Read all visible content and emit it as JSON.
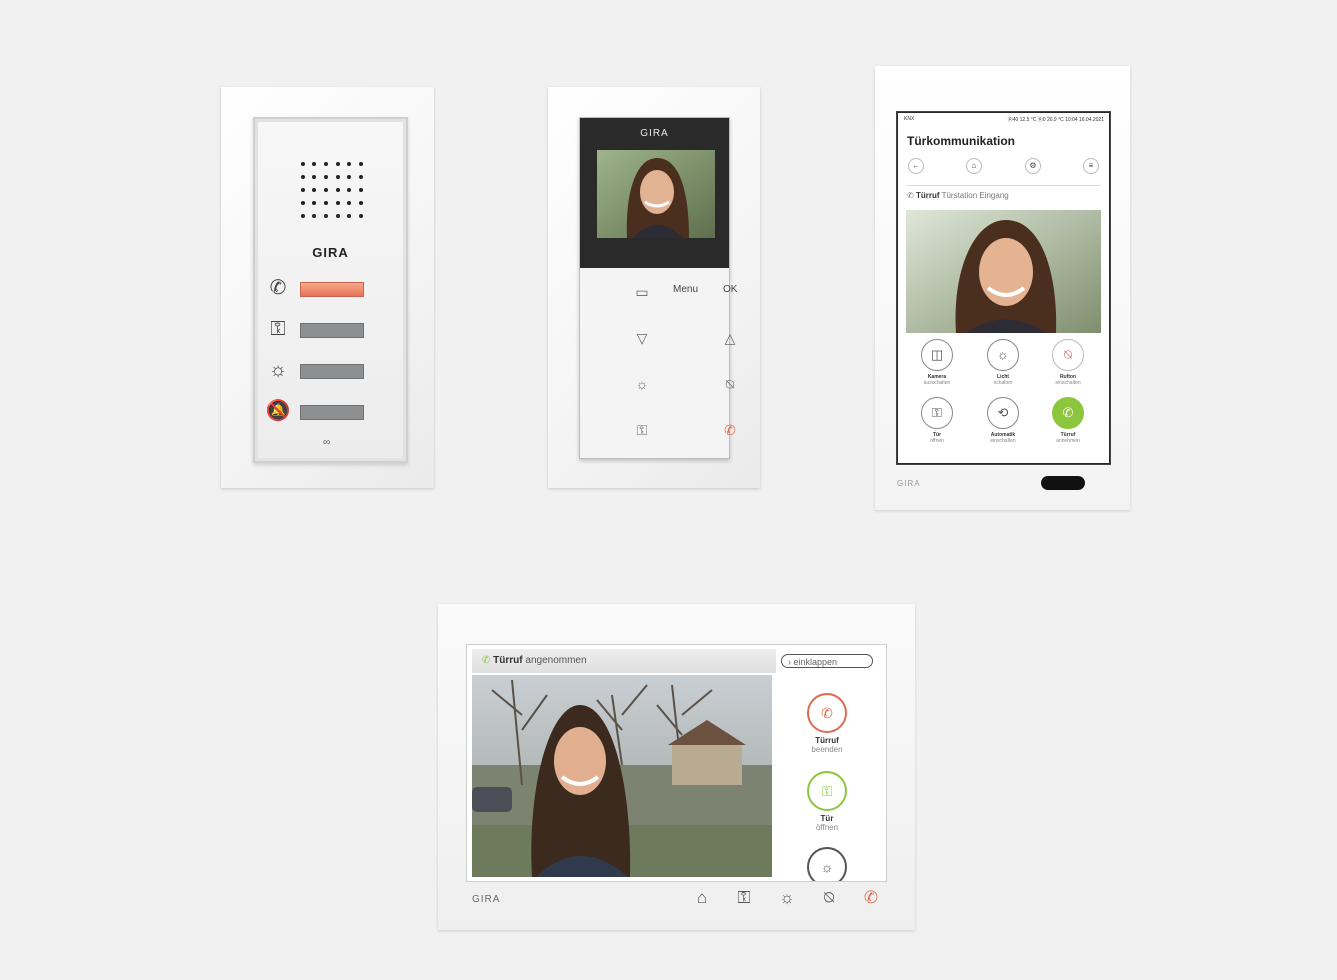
{
  "device1": {
    "brand": "GIRA",
    "icons": [
      "handset-icon",
      "key-icon",
      "light-icon",
      "bell-mute-icon"
    ],
    "glyphs": [
      "✆",
      "⚿",
      "☼",
      "🔕"
    ],
    "mini_symbol": "∞"
  },
  "device2": {
    "brand": "GIRA",
    "menu_label": "Menu",
    "ok_label": "OK",
    "glyphs": {
      "book": "▭",
      "down": "▽",
      "up": "△",
      "light": "☼",
      "mute": "⍉",
      "key": "⚿",
      "handset": "✆"
    }
  },
  "device3": {
    "status_left": "KNX",
    "status_right": "Ⓡ40 12.5 °C  Ⓡ0 20.9 °C  10:04  16.04.2021",
    "title": "Türkommunikation",
    "call_label": "Türruf",
    "call_source": "Türstation Eingang",
    "actions": [
      {
        "t1": "Kamera",
        "t2": "ausschalten",
        "glyph": "◫"
      },
      {
        "t1": "Licht",
        "t2": "schalten",
        "glyph": "☼"
      },
      {
        "t1": "Rufton",
        "t2": "einschalten",
        "glyph": "⍉"
      },
      {
        "t1": "Tür",
        "t2": "öffnen",
        "glyph": "⚿"
      },
      {
        "t1": "Automatik",
        "t2": "einschalten",
        "glyph": "⟲"
      },
      {
        "t1": "Türruf",
        "t2": "annehmen",
        "glyph": "✆"
      }
    ],
    "brand": "GIRA",
    "colors": {
      "accept": "#8cc63e",
      "reject": "#d9534f"
    }
  },
  "device4": {
    "header_bold": "Türruf",
    "header_rest": "angenommen",
    "collapse_label": "einklappen",
    "buttons": [
      {
        "t1": "Türruf",
        "t2": "beenden",
        "glyph": "✆",
        "color": "#e06a4f"
      },
      {
        "t1": "Tür",
        "t2": "öffnen",
        "glyph": "⚿",
        "color": "#8cc63e"
      },
      {
        "t1": "",
        "t2": "",
        "glyph": "☼",
        "color": "#555555"
      }
    ],
    "brand": "GIRA",
    "bottom_icons": [
      "⌂",
      "⚿",
      "☼",
      "⍉",
      "✆"
    ]
  }
}
